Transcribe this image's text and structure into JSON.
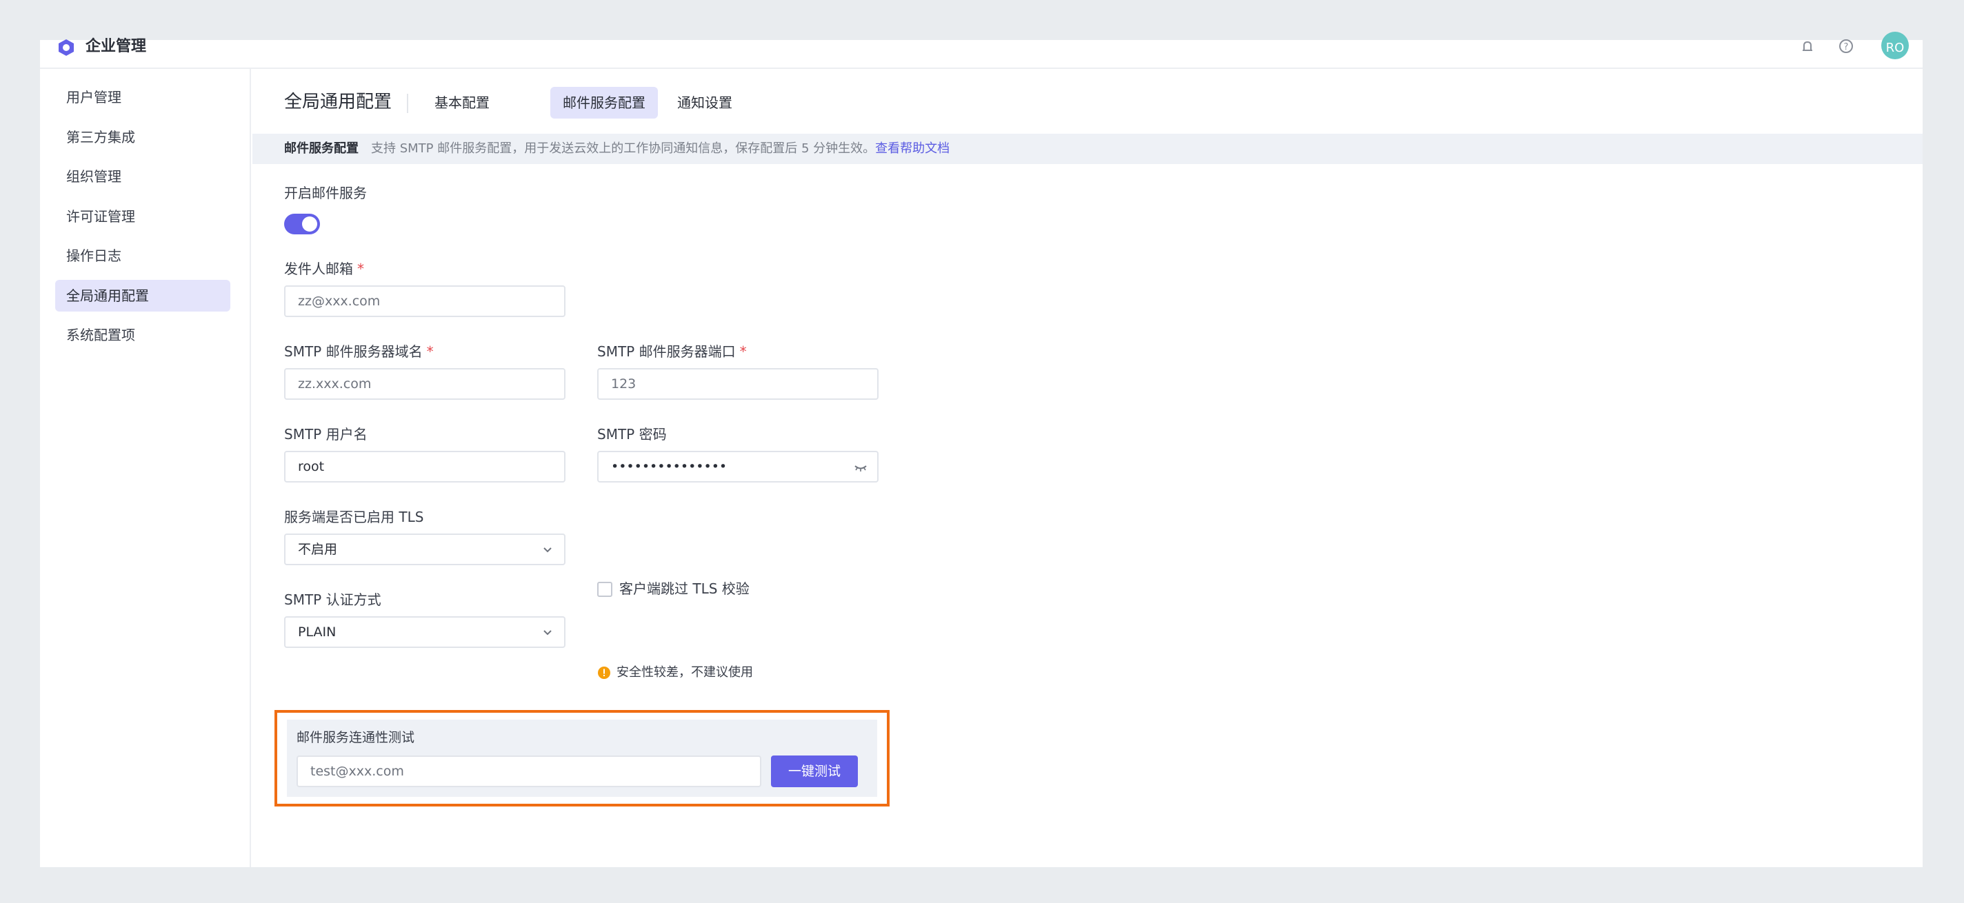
{
  "header": {
    "app_title": "企业管理",
    "avatar_text": "RO"
  },
  "sidebar": {
    "items": [
      {
        "label": "用户管理"
      },
      {
        "label": "第三方集成"
      },
      {
        "label": "组织管理"
      },
      {
        "label": "许可证管理"
      },
      {
        "label": "操作日志"
      },
      {
        "label": "全局通用配置",
        "active": true
      },
      {
        "label": "系统配置项"
      }
    ]
  },
  "main": {
    "page_title": "全局通用配置",
    "tabs": [
      {
        "label": "基本配置"
      },
      {
        "label": "邮件服务配置",
        "active": true
      },
      {
        "label": "通知设置"
      }
    ],
    "info_bar": {
      "title": "邮件服务配置",
      "description": "支持 SMTP 邮件服务配置，用于发送云效上的工作协同通知信息，保存配置后 5 分钟生效。",
      "link": "查看帮助文档"
    },
    "form": {
      "enable_label": "开启邮件服务",
      "enable_on": true,
      "sender_label": "发件人邮箱",
      "sender_placeholder": "zz@xxx.com",
      "required_mark": "*",
      "smtp_host_label": "SMTP 邮件服务器域名",
      "smtp_host_placeholder": "zz.xxx.com",
      "smtp_port_label": "SMTP 邮件服务器端口",
      "smtp_port_placeholder": "123",
      "smtp_user_label": "SMTP 用户名",
      "smtp_user_value": "root",
      "smtp_password_label": "SMTP 密码",
      "smtp_password_value": "•••••••••••••••",
      "tls_label": "服务端是否已启用 TLS",
      "tls_value": "不启用",
      "skip_tls_label": "客户端跳过 TLS 校验",
      "skip_tls_checked": false,
      "auth_label": "SMTP 认证方式",
      "auth_value": "PLAIN",
      "auth_warning": "安全性较差，不建议使用"
    },
    "test": {
      "label": "邮件服务连通性测试",
      "placeholder": "test@xxx.com",
      "button": "一键测试"
    }
  },
  "colors": {
    "accent": "#6360e8",
    "highlight_frame": "#f06d13",
    "warning": "#f59e0b",
    "required": "#e5484d",
    "avatar": "#63c7c4"
  }
}
